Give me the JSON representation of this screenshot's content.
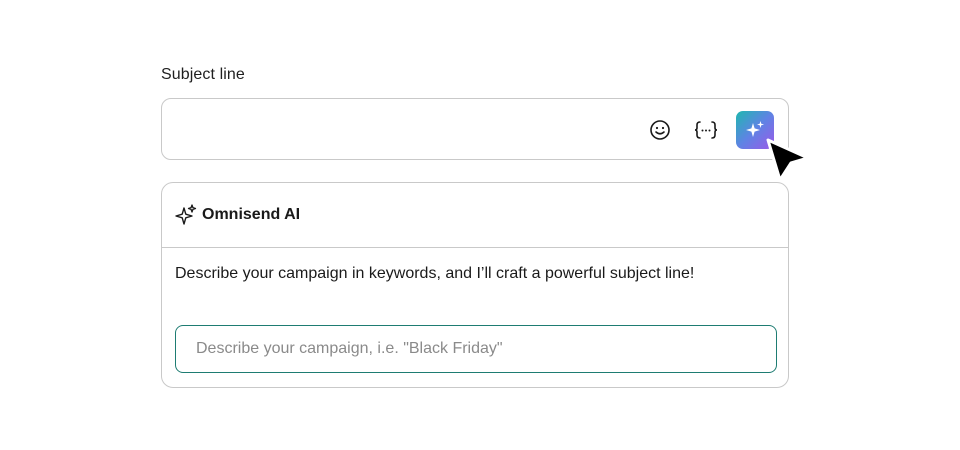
{
  "subject": {
    "label": "Subject line",
    "value": "",
    "icons": {
      "emoji": "smiley-icon",
      "variables": "curly-braces-icon",
      "ai": "sparkle-icon"
    }
  },
  "ai_panel": {
    "title": "Omnisend AI",
    "icon": "sparkle-outline-icon",
    "description": "Describe your campaign in keywords, and I’ll craft a powerful subject line!",
    "input_placeholder": "Describe your campaign, i.e. \"Black Friday\"",
    "input_value": ""
  },
  "colors": {
    "ai_gradient_start": "#1fb7b0",
    "ai_gradient_end": "#9b59e8",
    "input_focus_border": "#1e7c72"
  }
}
